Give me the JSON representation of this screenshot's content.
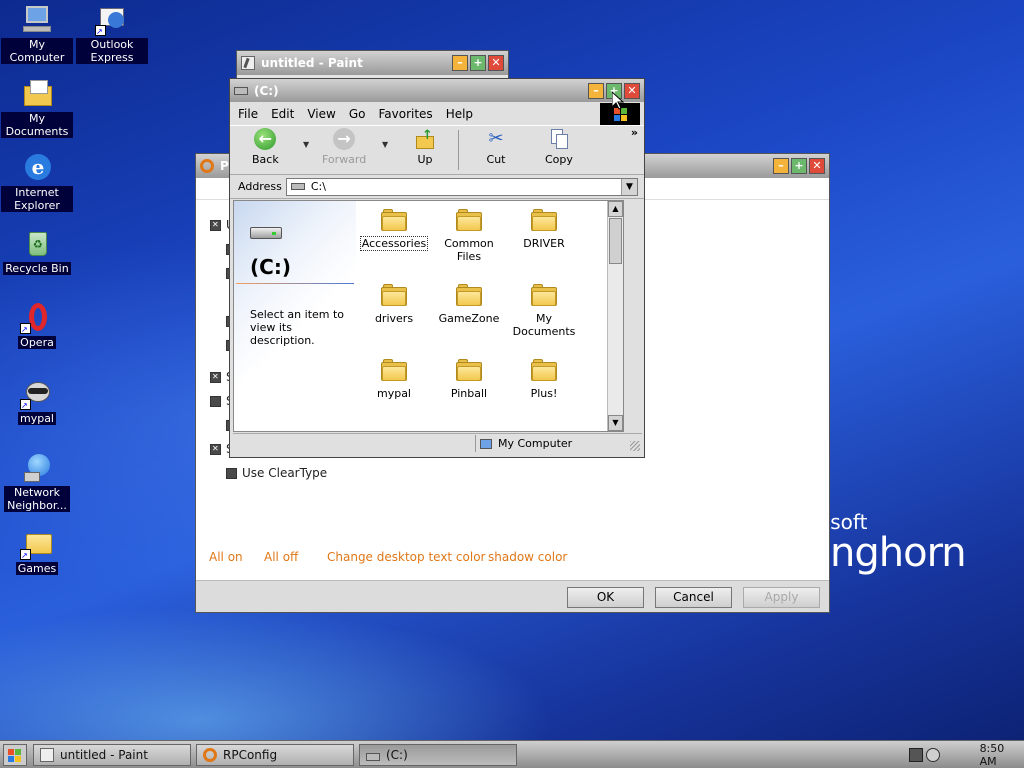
{
  "desktop": {
    "icons": [
      {
        "label": "My Computer",
        "icon": "my-computer-icon"
      },
      {
        "label": "Outlook Express",
        "icon": "outlook-express-icon"
      },
      {
        "label": "My Documents",
        "icon": "my-documents-icon"
      },
      {
        "label": "Internet Explorer",
        "icon": "internet-explorer-icon"
      },
      {
        "label": "Recycle Bin",
        "icon": "recycle-bin-icon"
      },
      {
        "label": "Opera",
        "icon": "opera-icon"
      },
      {
        "label": "mypal",
        "icon": "mypal-icon"
      },
      {
        "label": "Network Neighbor...",
        "icon": "network-neighborhood-icon"
      },
      {
        "label": "Games",
        "icon": "games-folder-icon"
      }
    ],
    "brand_line1": "osoft",
    "brand_line2": "nghorn"
  },
  "paint_window": {
    "title": "untitled - Paint"
  },
  "rpconfig_window": {
    "title_letter": "P",
    "options": [
      {
        "label": "U",
        "checked": true
      },
      {
        "label": "S",
        "checked": true
      },
      {
        "label": "S",
        "checked": false
      },
      {
        "label": "S",
        "checked": true
      },
      {
        "label": "Use ClearType",
        "checked": false
      }
    ],
    "links": {
      "all_on": "All on",
      "all_off": "All off",
      "change_color": "Change desktop text color",
      "shadow_color": "shadow color"
    },
    "buttons": {
      "ok": "OK",
      "cancel": "Cancel",
      "apply": "Apply"
    }
  },
  "explorer_window": {
    "title": "(C:)",
    "menu": [
      "File",
      "Edit",
      "View",
      "Go",
      "Favorites",
      "Help"
    ],
    "toolbar": {
      "back": "Back",
      "forward": "Forward",
      "up": "Up",
      "cut": "Cut",
      "copy": "Copy"
    },
    "address_label": "Address",
    "address_value": "C:\\",
    "left_pane": {
      "title": "(C:)",
      "description": "Select an item to view its description."
    },
    "folders": [
      "Accessories",
      "Common Files",
      "DRIVER",
      "drivers",
      "GameZone",
      "My Documents",
      "mypal",
      "Pinball",
      "Plus!"
    ],
    "selected_folder": "Accessories",
    "status_location": "My Computer"
  },
  "taskbar": {
    "tasks": [
      {
        "label": "untitled - Paint",
        "active": false
      },
      {
        "label": "RPConfig",
        "active": false
      },
      {
        "label": "(C:)",
        "active": true
      }
    ],
    "clock": "8:50 AM"
  }
}
